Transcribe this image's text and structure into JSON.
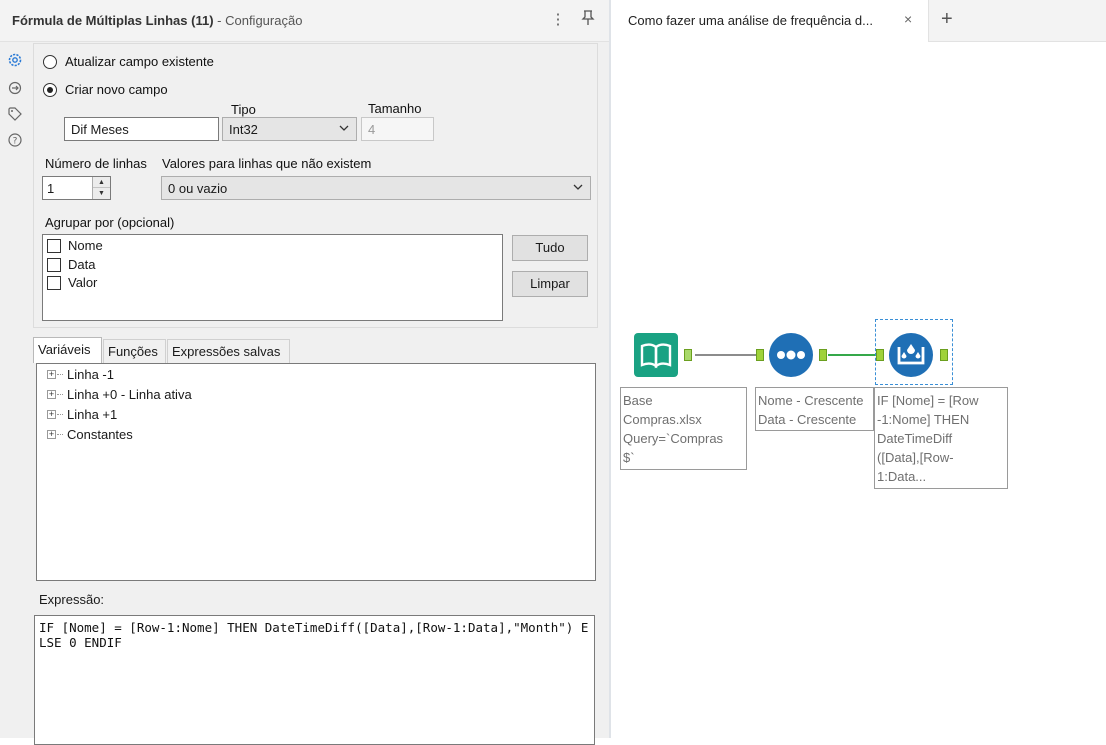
{
  "left_panel": {
    "title": "Fórmula de Múltiplas Linhas (11)",
    "subtitle": " - Configuração",
    "menu_glyph": "⋮",
    "pin_glyph": "📌",
    "radio_update": "Atualizar campo existente",
    "radio_create": "Criar novo campo",
    "new_field_value": "Dif Meses",
    "type_label": "Tipo",
    "type_value": "Int32",
    "size_label": "Tamanho",
    "size_value": "4",
    "num_rows_label": "Número de linhas",
    "num_rows_value": "1",
    "nonexist_label": "Valores para linhas que não existem",
    "nonexist_value": "0 ou vazio",
    "group_by_label": "Agrupar por (opcional)",
    "group_fields": [
      "Nome",
      "Data",
      "Valor"
    ],
    "btn_all": "Tudo",
    "btn_clear": "Limpar",
    "tabs": [
      "Variáveis",
      "Funções",
      "Expressões salvas"
    ],
    "tree_items": [
      "Linha -1",
      "Linha +0 - Linha ativa",
      "Linha +1",
      "Constantes"
    ],
    "expression_label": "Expressão:",
    "expression": "IF [Nome] = [Row-1:Nome] THEN DateTimeDiff([Data],[Row-1:Data],\"Month\") ELSE 0 ENDIF"
  },
  "right_panel": {
    "tab_title": "Como fazer uma análise de frequência d...",
    "tab_close": "×",
    "new_tab": "+",
    "tools": [
      {
        "name": "input-data",
        "annotation": "Base Compras.xlsx Query=`Compras $`"
      },
      {
        "name": "sort",
        "annotation": "Nome - Crescente Data - Crescente"
      },
      {
        "name": "multi-row-formula",
        "annotation": "IF [Nome] = [Row -1:Nome] THEN DateTimeDiff ([Data],[Row-1:Data..."
      }
    ],
    "annotation_lines": {
      "input": [
        "Base",
        "Compras.xlsx",
        "Query=`Compras",
        "$`"
      ],
      "sort": [
        "Nome - Crescente",
        "Data - Crescente"
      ],
      "formula": [
        "IF [Nome] = [Row",
        "-1:Nome] THEN",
        "DateTimeDiff",
        "([Data],[Row-",
        "1:Data..."
      ]
    }
  },
  "colors": {
    "input_tool": "#1aa283",
    "sort_tool": "#1f6fb5",
    "formula_tool": "#1f6fb5",
    "connector": "#35a84a",
    "anchor": "#9fd23a"
  }
}
